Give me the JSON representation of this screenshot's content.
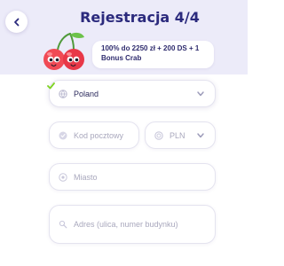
{
  "header": {
    "title": "Rejestracja 4/4",
    "bonus_text": "100% do 2250 zł + 200 DS + 1 Bonus Crab"
  },
  "form": {
    "country_value": "Poland",
    "postcode_placeholder": "Kod pocztowy",
    "currency_value": "PLN",
    "city_placeholder": "Miasto",
    "address_placeholder": "Adres (ulica, numer budynku)"
  },
  "colors": {
    "header_bg": "#ecebf9",
    "title": "#2b2a7d",
    "check": "#7ed321",
    "cherry_red": "#f04a55",
    "stem_green": "#4f9a3a"
  }
}
